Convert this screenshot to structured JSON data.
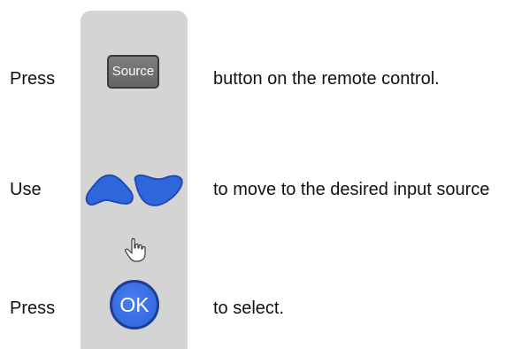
{
  "steps": [
    {
      "label": "Press",
      "control_label": "Source",
      "text": "button on the remote control."
    },
    {
      "label": "Use",
      "controls": [
        "left-arrow-key-icon",
        "right-arrow-key-icon"
      ],
      "text": "to move to the desired input source"
    },
    {
      "label": "Press",
      "control_label": "OK",
      "text": "to select."
    }
  ],
  "colors": {
    "panel": "#d4d4d4",
    "source_button": "#707070",
    "arrow_key": "#2f66dc",
    "ok_button": "#2d63db"
  },
  "icons": {
    "hand": "hand-pointer-icon"
  }
}
